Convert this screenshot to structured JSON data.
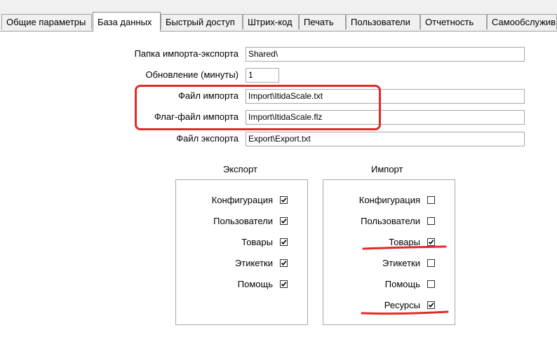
{
  "tabs": [
    {
      "label": "Общие параметры",
      "active": false
    },
    {
      "label": "База данных",
      "active": true
    },
    {
      "label": "Быстрый доступ",
      "active": false
    },
    {
      "label": "Штрих-код",
      "active": false
    },
    {
      "label": "Печать",
      "active": false
    },
    {
      "label": "Пользователи",
      "active": false
    },
    {
      "label": "Отчетность",
      "active": false
    },
    {
      "label": "Самообслужив",
      "active": false
    }
  ],
  "fields": {
    "import_export_folder": {
      "label": "Папка импорта-экспорта",
      "value": "Shared\\"
    },
    "refresh_minutes": {
      "label": "Обновление (минуты)",
      "value": "1"
    },
    "import_file": {
      "label": "Файл импорта",
      "value": "Import\\ItidaScale.txt"
    },
    "import_flag_file": {
      "label": "Флаг-файл импорта",
      "value": "Import\\ItidaScale.flz"
    },
    "export_file": {
      "label": "Файл экспорта",
      "value": "Export\\Export.txt"
    }
  },
  "export_group": {
    "title": "Экспорт",
    "items": [
      {
        "label": "Конфигурация",
        "checked": true
      },
      {
        "label": "Пользователи",
        "checked": true
      },
      {
        "label": "Товары",
        "checked": true
      },
      {
        "label": "Этикетки",
        "checked": true
      },
      {
        "label": "Помощь",
        "checked": true
      }
    ]
  },
  "import_group": {
    "title": "Импорт",
    "items": [
      {
        "label": "Конфигурация",
        "checked": false
      },
      {
        "label": "Пользователи",
        "checked": false
      },
      {
        "label": "Товары",
        "checked": true
      },
      {
        "label": "Этикетки",
        "checked": false
      },
      {
        "label": "Помощь",
        "checked": false
      },
      {
        "label": "Ресурсы",
        "checked": true
      }
    ]
  },
  "annotation_color": "#e02a2a"
}
